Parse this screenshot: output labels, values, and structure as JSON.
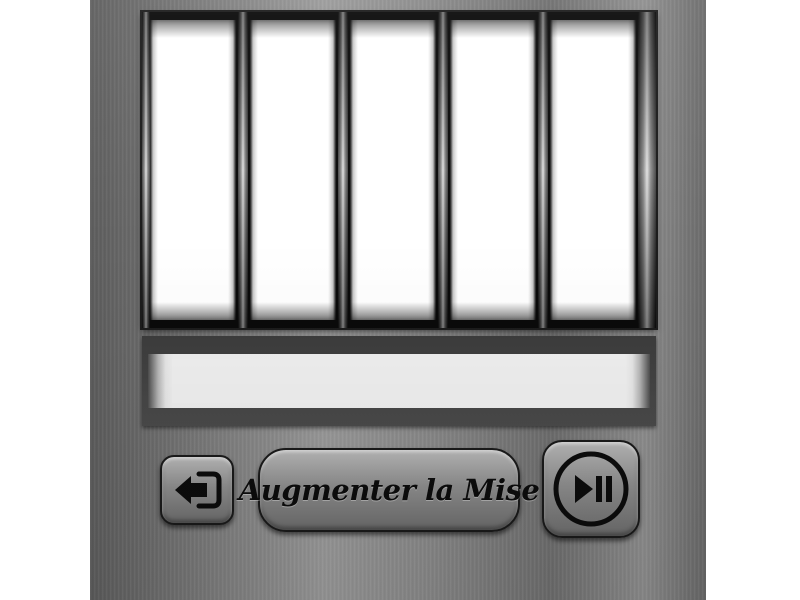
{
  "game": {
    "reels": [
      {
        "symbol": ""
      },
      {
        "symbol": ""
      },
      {
        "symbol": ""
      },
      {
        "symbol": ""
      },
      {
        "symbol": ""
      }
    ],
    "message": ""
  },
  "controls": {
    "back_icon": "exit-arrow-icon",
    "raise_bet_label": "Augmenter la Mise",
    "play_pause_icon": "play-pause-icon"
  },
  "colors": {
    "panel": "#8a8a8a",
    "frame": "#0a0a0a",
    "reel_face": "#ffffff",
    "button": "#8d8d8d",
    "button_text": "#0c0c0c"
  }
}
